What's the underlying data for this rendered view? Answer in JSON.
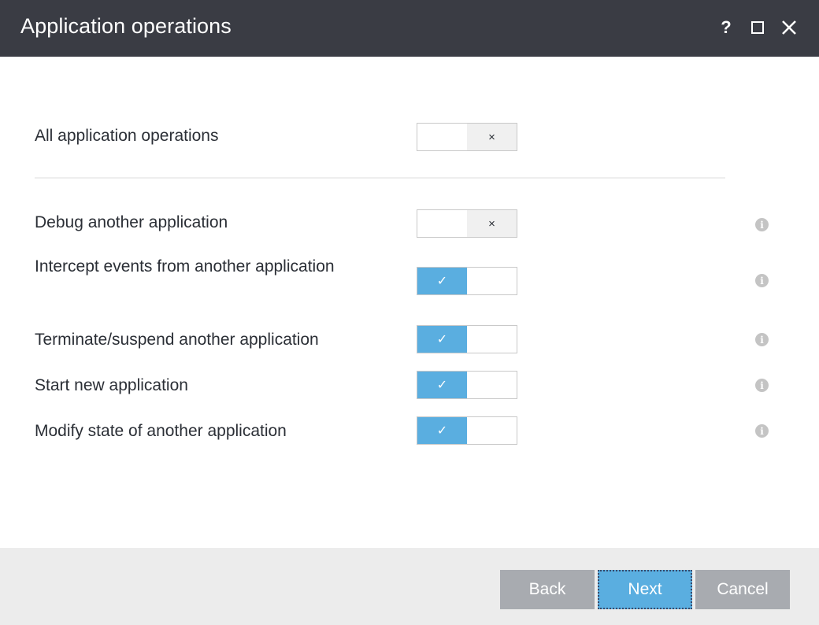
{
  "window": {
    "title": "Application operations",
    "help_glyph": "?",
    "close_glyph": "✕"
  },
  "master": {
    "label": "All application operations",
    "state": "off",
    "off_glyph": "×"
  },
  "operations": [
    {
      "label": "Debug another application",
      "state": "off",
      "glyph": "×"
    },
    {
      "label": "Intercept events from another application",
      "state": "on",
      "glyph": "✓"
    },
    {
      "label": "Terminate/suspend another application",
      "state": "on",
      "glyph": "✓"
    },
    {
      "label": "Start new application",
      "state": "on",
      "glyph": "✓"
    },
    {
      "label": "Modify state of another application",
      "state": "on",
      "glyph": "✓"
    }
  ],
  "info_glyph": "i",
  "footer": {
    "back_label": "Back",
    "next_label": "Next",
    "cancel_label": "Cancel"
  },
  "colors": {
    "titlebar": "#3a3c44",
    "accent": "#5aaee0",
    "button_gray": "#a8abb0"
  }
}
